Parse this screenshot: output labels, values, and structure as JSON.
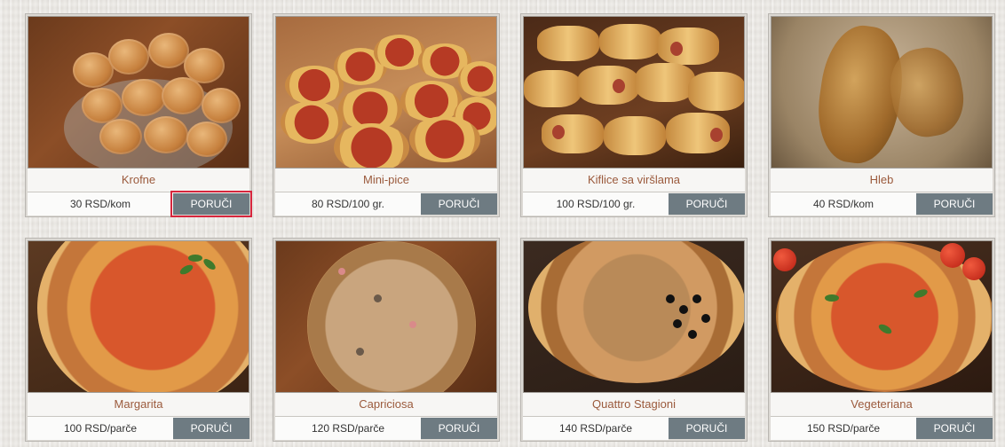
{
  "products": [
    {
      "name": "Krofne",
      "price": "30 RSD/kom",
      "button": "PORUČI"
    },
    {
      "name": "Mini-pice",
      "price": "80 RSD/100 gr.",
      "button": "PORUČI"
    },
    {
      "name": "Kiflice sa viršlama",
      "price": "100 RSD/100 gr.",
      "button": "PORUČI"
    },
    {
      "name": "Hleb",
      "price": "40 RSD/kom",
      "button": "PORUČI"
    },
    {
      "name": "Margarita",
      "price": "100 RSD/parče",
      "button": "PORUČI"
    },
    {
      "name": "Capriciosa",
      "price": "120 RSD/parče",
      "button": "PORUČI"
    },
    {
      "name": "Quattro Stagioni",
      "price": "140 RSD/parče",
      "button": "PORUČI"
    },
    {
      "name": "Vegeteriana",
      "price": "150 RSD/parče",
      "button": "PORUČI"
    }
  ],
  "colors": {
    "title": "#9b5a3c",
    "button": "#6e7b82",
    "focus": "#d7263d"
  }
}
